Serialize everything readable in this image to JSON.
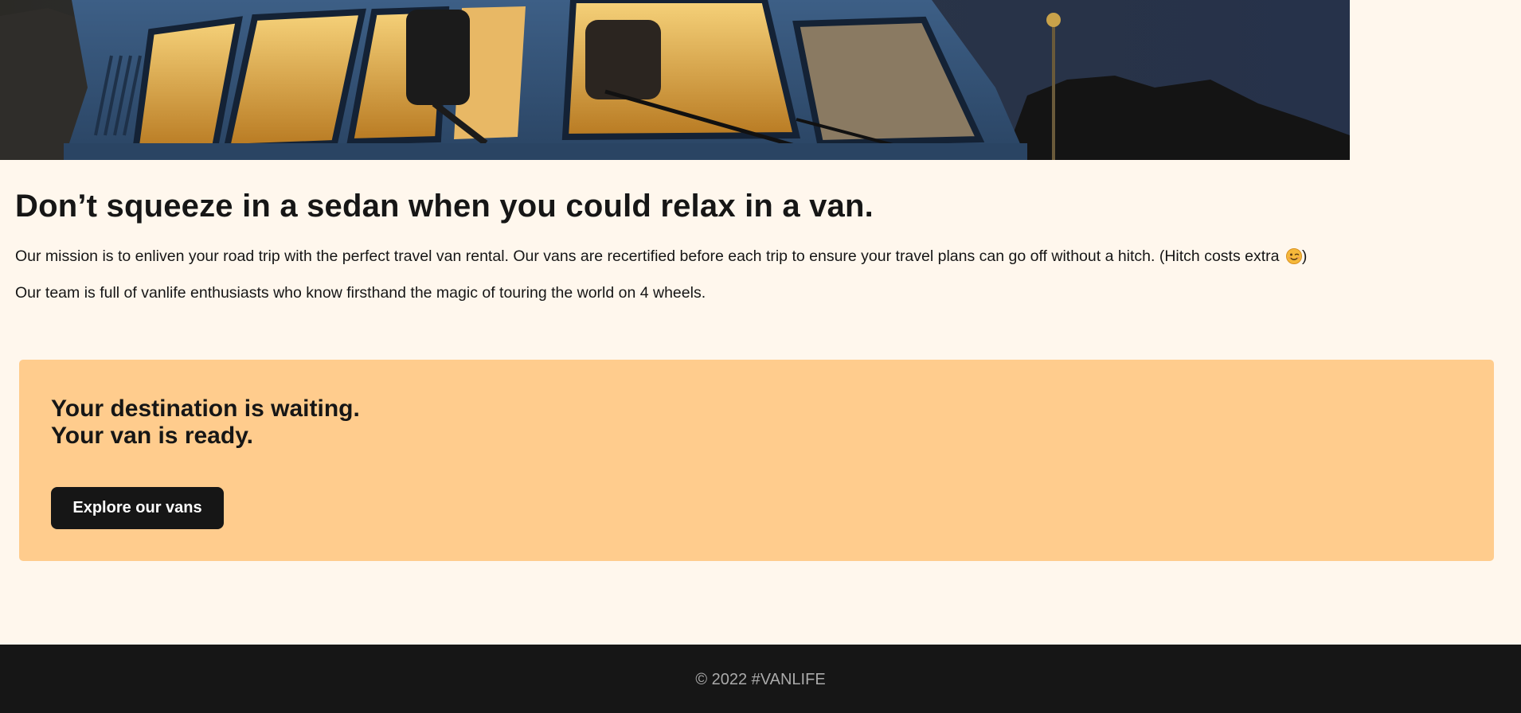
{
  "about": {
    "heading": "Don’t squeeze in a sedan when you could relax in a van.",
    "paragraph1": "Our mission is to enliven your road trip with the perfect travel van rental. Our vans are recertified before each trip to ensure your travel plans can go off without a hitch. (Hitch costs extra ",
    "paragraph1_end": ")",
    "paragraph2": "Our team is full of vanlife enthusiasts who know firsthand the magic of touring the world on 4 wheels."
  },
  "cta": {
    "line1": "Your destination is waiting.",
    "line2": "Your van is ready.",
    "button_label": "Explore our vans"
  },
  "footer": {
    "copyright": "© 2022 #VANLIFE"
  },
  "colors": {
    "page_background": "#FFF7ED",
    "cta_background": "#FFCC8D",
    "button_background": "#161616",
    "footer_background": "#161616",
    "footer_text": "#AAAAAA"
  },
  "icons": {
    "wink": "winking-face-emoji"
  }
}
